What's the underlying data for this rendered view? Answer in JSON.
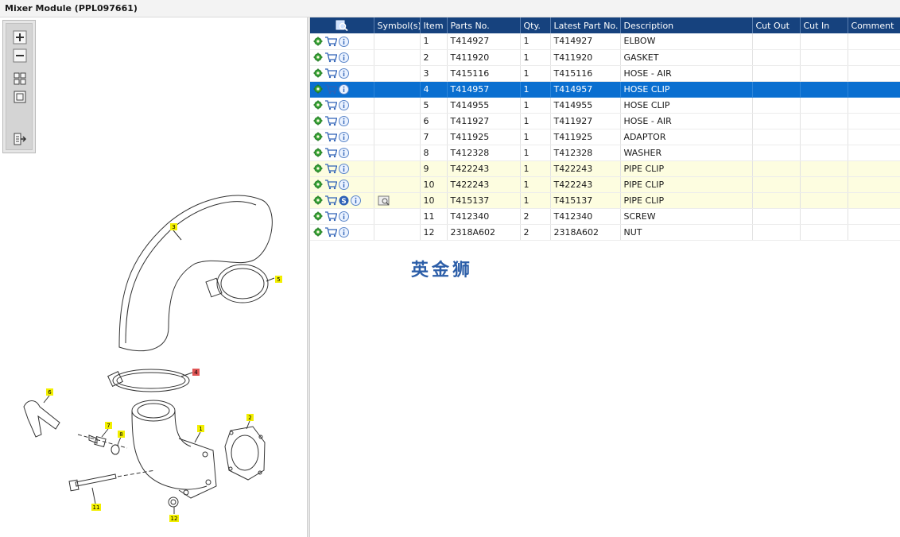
{
  "window": {
    "title": "Mixer Module (PPL097661)"
  },
  "toolbox": {
    "tools": [
      "zoom-in-icon",
      "zoom-out-icon",
      "fit-all-icon",
      "actual-size-icon",
      "export-icon"
    ]
  },
  "drawing": {
    "callouts": [
      "1",
      "2",
      "3",
      "4",
      "5",
      "6",
      "7",
      "8",
      "11",
      "12"
    ],
    "highlighted_callout": "4"
  },
  "table": {
    "columns": [
      "",
      "Symbol(s)",
      "Item",
      "Parts No.",
      "Qty.",
      "Latest Part No.",
      "Description",
      "Cut Out",
      "Cut In",
      "Comment"
    ],
    "rows": [
      {
        "item": "1",
        "part": "T414927",
        "qty": "1",
        "latest": "T414927",
        "desc": "ELBOW",
        "state": ""
      },
      {
        "item": "2",
        "part": "T411920",
        "qty": "1",
        "latest": "T411920",
        "desc": "GASKET",
        "state": ""
      },
      {
        "item": "3",
        "part": "T415116",
        "qty": "1",
        "latest": "T415116",
        "desc": "HOSE - AIR",
        "state": ""
      },
      {
        "item": "4",
        "part": "T414957",
        "qty": "1",
        "latest": "T414957",
        "desc": "HOSE CLIP",
        "state": "selected"
      },
      {
        "item": "5",
        "part": "T414955",
        "qty": "1",
        "latest": "T414955",
        "desc": "HOSE CLIP",
        "state": ""
      },
      {
        "item": "6",
        "part": "T411927",
        "qty": "1",
        "latest": "T411927",
        "desc": "HOSE - AIR",
        "state": ""
      },
      {
        "item": "7",
        "part": "T411925",
        "qty": "1",
        "latest": "T411925",
        "desc": "ADAPTOR",
        "state": ""
      },
      {
        "item": "8",
        "part": "T412328",
        "qty": "1",
        "latest": "T412328",
        "desc": "WASHER",
        "state": ""
      },
      {
        "item": "9",
        "part": "T422243",
        "qty": "1",
        "latest": "T422243",
        "desc": "PIPE CLIP",
        "state": "highlight"
      },
      {
        "item": "10",
        "part": "T422243",
        "qty": "1",
        "latest": "T422243",
        "desc": "PIPE CLIP",
        "state": "highlight"
      },
      {
        "item": "10",
        "part": "T415137",
        "qty": "1",
        "latest": "T415137",
        "desc": "PIPE CLIP",
        "state": "highlight",
        "service_icon": true,
        "symbol_icon": true
      },
      {
        "item": "11",
        "part": "T412340",
        "qty": "2",
        "latest": "T412340",
        "desc": "SCREW",
        "state": ""
      },
      {
        "item": "12",
        "part": "2318A602",
        "qty": "2",
        "latest": "2318A602",
        "desc": "NUT",
        "state": ""
      }
    ]
  },
  "watermark": {
    "text": "英金狮"
  },
  "colors": {
    "header": "#16427e",
    "selected": "#0a6fd0",
    "highlight": "#fdfde0",
    "callout": "#f2ef00",
    "callout_selected": "#e05555"
  }
}
